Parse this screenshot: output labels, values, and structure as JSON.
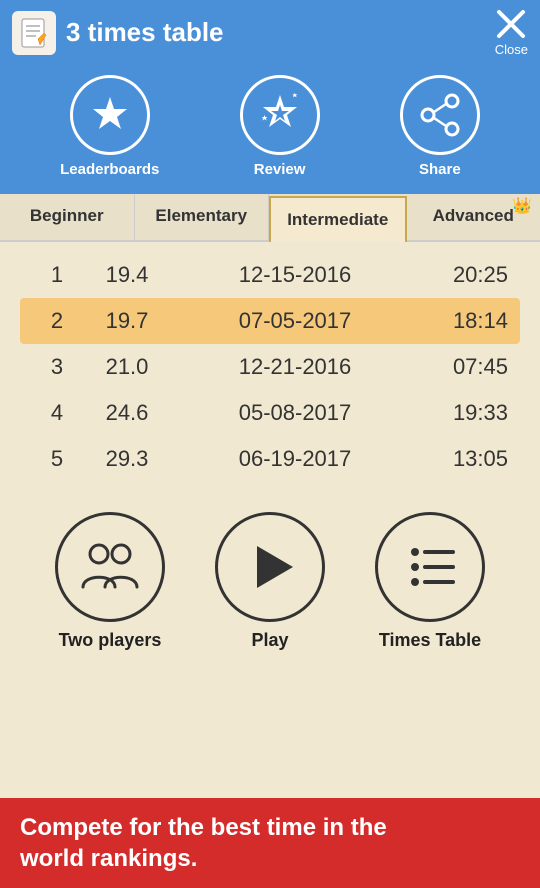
{
  "header": {
    "title": "3 times table",
    "icon": "📝",
    "close_label": "Close"
  },
  "icon_bar": {
    "items": [
      {
        "id": "leaderboards",
        "label": "Leaderboards"
      },
      {
        "id": "review",
        "label": "Review"
      },
      {
        "id": "share",
        "label": "Share"
      }
    ]
  },
  "tabs": [
    {
      "id": "beginner",
      "label": "Beginner",
      "active": false
    },
    {
      "id": "elementary",
      "label": "Elementary",
      "active": false
    },
    {
      "id": "intermediate",
      "label": "Intermediate",
      "active": true
    },
    {
      "id": "advanced",
      "label": "Advanced",
      "active": false,
      "crown": true
    }
  ],
  "scores": [
    {
      "rank": "1",
      "time": "19.4",
      "date": "12-15-2016",
      "clock": "20:25",
      "highlight": false
    },
    {
      "rank": "2",
      "time": "19.7",
      "date": "07-05-2017",
      "clock": "18:14",
      "highlight": true
    },
    {
      "rank": "3",
      "time": "21.0",
      "date": "12-21-2016",
      "clock": "07:45",
      "highlight": false
    },
    {
      "rank": "4",
      "time": "24.6",
      "date": "05-08-2017",
      "clock": "19:33",
      "highlight": false
    },
    {
      "rank": "5",
      "time": "29.3",
      "date": "06-19-2017",
      "clock": "13:05",
      "highlight": false
    }
  ],
  "bottom": {
    "two_players_label": "Two players",
    "play_label": "Play",
    "times_table_label": "Times Table"
  },
  "banner": {
    "line1": "Compete for the best time in the",
    "line2": "world rankings."
  }
}
